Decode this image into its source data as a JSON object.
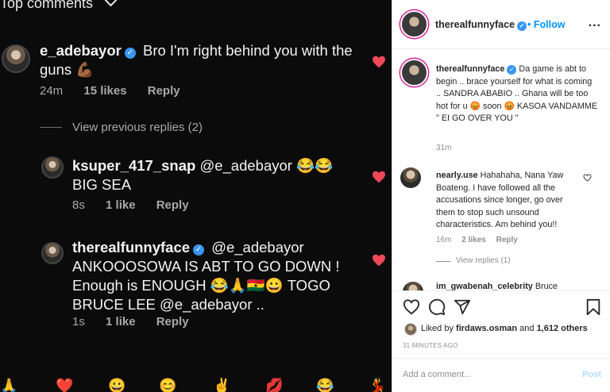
{
  "left": {
    "top_label": "Top comments",
    "comments": [
      {
        "user": "e_adebayor",
        "text": "Bro I'm right behind you with the guns 💪🏾",
        "time": "24m",
        "likes": "15 likes",
        "reply": "Reply"
      },
      {
        "user": "ksuper_417_snap",
        "text": "@e_adebayor 😂😂 BIG SEA",
        "time": "8s",
        "likes": "1 like",
        "reply": "Reply"
      },
      {
        "user": "therealfunnyface",
        "text": "@e_adebayor ANKOOOSOWA IS ABT TO GO DOWN ! Enough is ENOUGH 😂🙏🇬🇭😀 TOGO BRUCE LEE @e_adebayor ..",
        "time": "1s",
        "likes": "1 like",
        "reply": "Reply"
      }
    ],
    "view_previous": "View previous replies (2)",
    "emoji_bar": [
      "🙏",
      "❤️",
      "😀",
      "😊",
      "✌️",
      "💋",
      "😂",
      "💃"
    ]
  },
  "right": {
    "header": {
      "username": "therealfunnyface",
      "follow": "Follow",
      "more": "..."
    },
    "caption": {
      "user": "therealfunnyface",
      "text": "Da game is abt to begin .. brace yourself for what is coming .. SANDRA ABABIO .. Ghana will be too hot for u 😡 soon 😡 KASOA VANDAMME \" EI GO OVER YOU \"",
      "time": "31m"
    },
    "comments": [
      {
        "user": "nearly.use",
        "text": "Hahahaha, Nana Yaw Boateng. I have followed all the accusations since longer, go over them to stop such unsound characteristics. Am behind you!!",
        "time": "16m",
        "likes": "2 likes",
        "reply": "Reply",
        "view_replies": "View replies (1)"
      },
      {
        "user": "im_gwabenah_celebrity",
        "text": "Bruce"
      }
    ],
    "liked_by": {
      "prefix": "Liked by",
      "user": "firdaws.osman",
      "mid": "and",
      "count": "1,612 others"
    },
    "posted_ago": "31 MINUTES AGO",
    "add_comment": {
      "placeholder": "Add a comment...",
      "post": "Post"
    },
    "colors": {
      "accent": "#0095f6",
      "heart": "#ed4956"
    }
  }
}
